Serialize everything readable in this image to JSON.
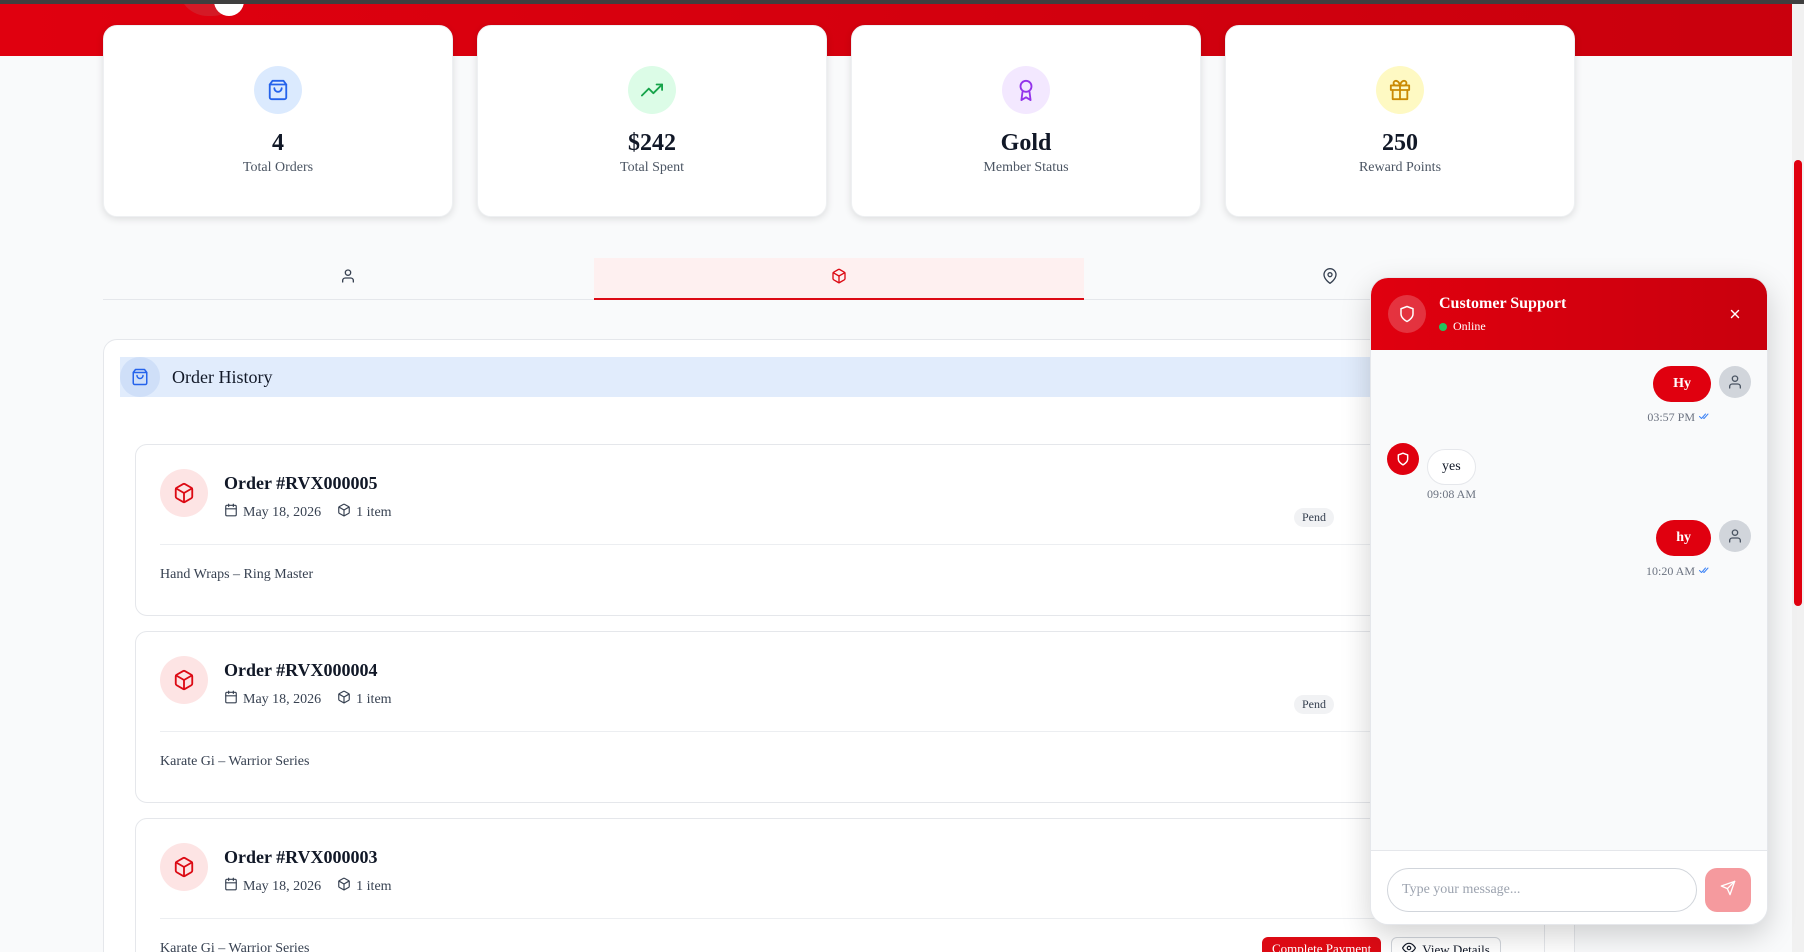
{
  "stats": [
    {
      "value": "4",
      "label": "Total Orders",
      "icon": "shopping-bag-icon",
      "icon_bg": "#dbeafe",
      "icon_color": "#2563eb"
    },
    {
      "value": "$242",
      "label": "Total Spent",
      "icon": "trending-up-icon",
      "icon_bg": "#dcfce7",
      "icon_color": "#16a34a"
    },
    {
      "value": "Gold",
      "label": "Member Status",
      "icon": "award-icon",
      "icon_bg": "#f3e8ff",
      "icon_color": "#9333ea"
    },
    {
      "value": "250",
      "label": "Reward Points",
      "icon": "gift-icon",
      "icon_bg": "#fef9c3",
      "icon_color": "#ca8a04"
    }
  ],
  "tabs": [
    {
      "icon": "user-icon",
      "active": false
    },
    {
      "icon": "package-icon",
      "active": true
    },
    {
      "icon": "map-pin-icon",
      "active": false
    }
  ],
  "order_history": {
    "title": "Order History",
    "orders": [
      {
        "number": "Order #RVX000005",
        "date": "May 18, 2026",
        "items": "1 item",
        "status": "Pend",
        "product": "Hand Wraps – Ring Master"
      },
      {
        "number": "Order #RVX000004",
        "date": "May 18, 2026",
        "items": "1 item",
        "status": "Pend",
        "product": "Karate Gi – Warrior Series"
      },
      {
        "number": "Order #RVX000003",
        "date": "May 18, 2026",
        "items": "1 item",
        "status": "",
        "product": "Karate Gi – Warrior Series",
        "actions": {
          "pay": "Complete Payment",
          "view": "View Details"
        }
      }
    ]
  },
  "chat": {
    "title": "Customer Support",
    "status": "Online",
    "messages": [
      {
        "from": "user",
        "text": "Hy",
        "time": "03:57 PM"
      },
      {
        "from": "agent",
        "text": "yes",
        "time": "09:08 AM"
      },
      {
        "from": "user",
        "text": "hy",
        "time": "10:20 AM"
      }
    ],
    "input_placeholder": "Type your message..."
  },
  "colors": {
    "brand": "#e0000f",
    "online": "#22c55e"
  }
}
